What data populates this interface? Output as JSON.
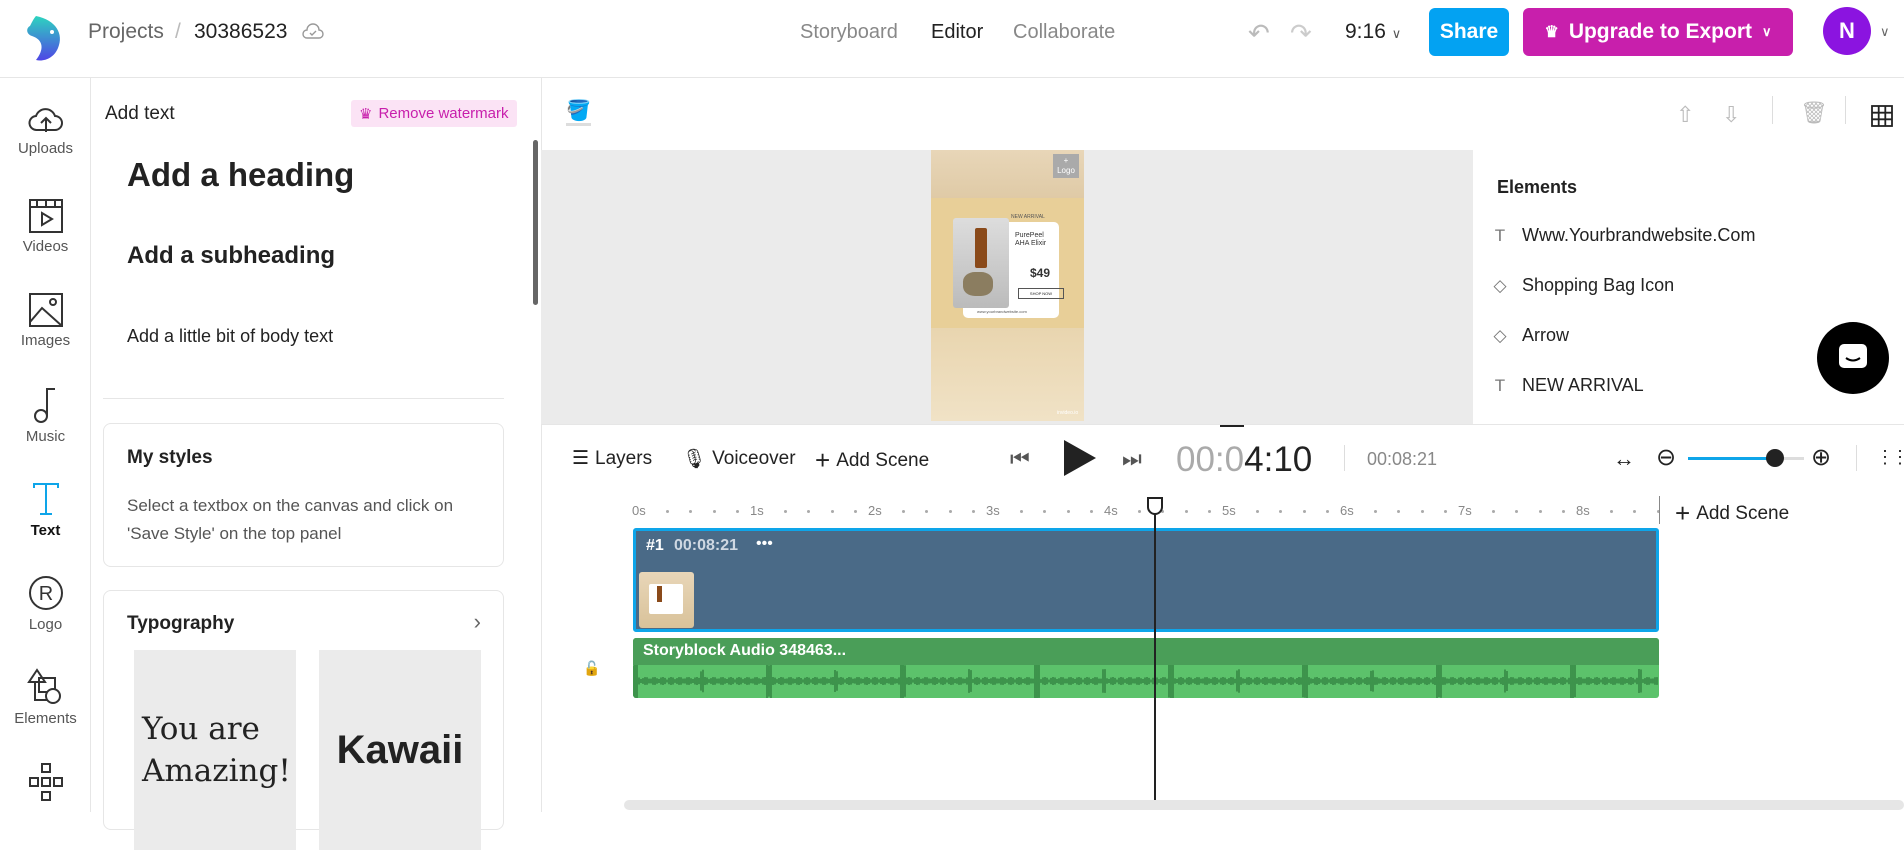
{
  "header": {
    "breadcrumb_root": "Projects",
    "separator": "/",
    "project_id": "30386523",
    "nav": [
      "Storyboard",
      "Editor",
      "Collaborate"
    ],
    "active_nav": "Editor",
    "aspect_ratio": "9:16",
    "share_label": "Share",
    "upgrade_label": "Upgrade to Export",
    "avatar_initial": "N"
  },
  "rail": [
    {
      "label": "Uploads",
      "icon": "upload-cloud-icon"
    },
    {
      "label": "Videos",
      "icon": "video-icon"
    },
    {
      "label": "Images",
      "icon": "image-icon"
    },
    {
      "label": "Music",
      "icon": "music-note-icon"
    },
    {
      "label": "Text",
      "icon": "text-icon",
      "active": true
    },
    {
      "label": "Logo",
      "icon": "registered-icon"
    },
    {
      "label": "Elements",
      "icon": "shapes-icon"
    }
  ],
  "panel": {
    "title": "Add text",
    "remove_watermark": "Remove watermark",
    "heading": "Add a heading",
    "subheading": "Add a subheading",
    "body": "Add a little bit of body text",
    "my_styles_title": "My styles",
    "my_styles_desc": "Select a textbox on the canvas and click on 'Save Style' on the top panel",
    "typography_title": "Typography",
    "typography_samples": [
      "You are Amazing!",
      "Kawaii"
    ]
  },
  "preview": {
    "logo_label": "Logo",
    "new_arrival": "NEW ARRIVAL",
    "product_name": "PurePeel AHA Elixir",
    "price": "$49",
    "shop_now": "SHOP NOW",
    "website": "www.yourbrandwebsite.com",
    "watermark": "invideo.io"
  },
  "elements": {
    "title": "Elements",
    "items": [
      {
        "type": "text",
        "label": "Www.Yourbrandwebsite.Com"
      },
      {
        "type": "shape",
        "label": "Shopping Bag Icon"
      },
      {
        "type": "shape",
        "label": "Arrow"
      },
      {
        "type": "text",
        "label": "NEW ARRIVAL"
      }
    ]
  },
  "timeline": {
    "layers_label": "Layers",
    "voiceover_label": "Voiceover",
    "add_scene_label": "Add Scene",
    "current_time_dim": "00:0",
    "current_time": "4:10",
    "total_time": "00:08:21",
    "zoom_level": 0.75,
    "ticks": [
      "0s",
      "1s",
      "2s",
      "3s",
      "4s",
      "5s",
      "6s",
      "7s",
      "8s"
    ],
    "add_scene_right": "Add Scene",
    "scene_number": "#1",
    "scene_duration": "00:08:21",
    "scene_more": "•••",
    "audio_label": "Storyblock Audio 348463...",
    "playhead_seconds": 4.33,
    "colors": {
      "scene": "#4a6a87",
      "audio": "#5cc26b",
      "accent": "#0ea5e9"
    }
  }
}
